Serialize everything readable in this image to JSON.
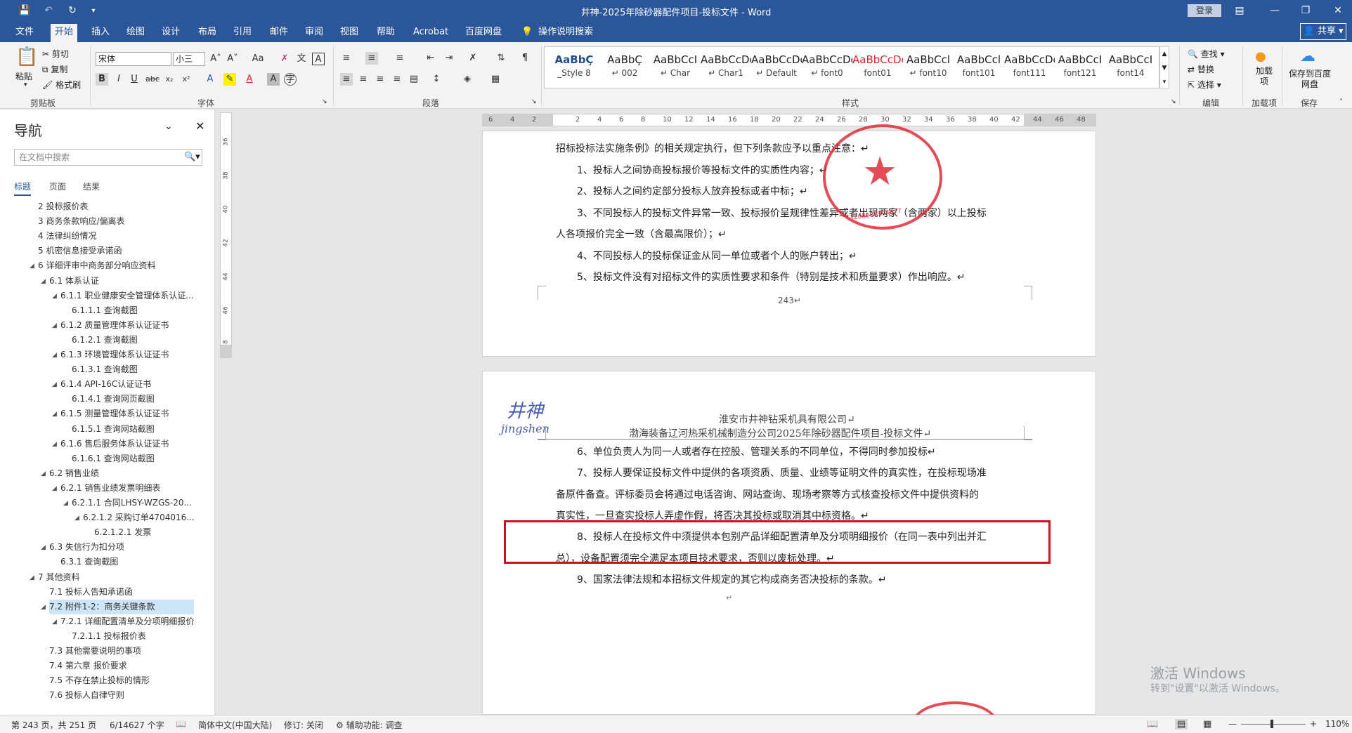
{
  "window": {
    "title": "井神-2025年除砂器配件项目-投标文件 - Word",
    "login_label": "登录",
    "share_label": "共享"
  },
  "tabs": [
    "文件",
    "开始",
    "插入",
    "绘图",
    "设计",
    "布局",
    "引用",
    "邮件",
    "审阅",
    "视图",
    "帮助",
    "Acrobat",
    "百度网盘"
  ],
  "tell_me": "操作说明搜索",
  "ribbon": {
    "clipboard": {
      "paste": "粘贴",
      "cut": "剪切",
      "copy": "复制",
      "format_painter": "格式刷",
      "label": "剪贴板"
    },
    "font": {
      "name": "宋体",
      "size": "小三",
      "label": "字体",
      "change_case": "Aa"
    },
    "paragraph": {
      "label": "段落"
    },
    "styles": {
      "label": "样式",
      "items": [
        {
          "sample": "AaBbÇ",
          "name": "_Style 8",
          "color": "#1f4e8c"
        },
        {
          "sample": "AaBbÇ",
          "name": "↵ 002",
          "color": "#222"
        },
        {
          "sample": "AaBbCcI",
          "name": "↵ Char",
          "color": "#222"
        },
        {
          "sample": "AaBbCcDc",
          "name": "↵ Char1",
          "color": "#222"
        },
        {
          "sample": "AaBbCcDc",
          "name": "↵ Default",
          "color": "#222"
        },
        {
          "sample": "AaBbCcDc",
          "name": "↵ font0",
          "color": "#222"
        },
        {
          "sample": "AaBbCcDc",
          "name": "font01",
          "color": "#e0242f"
        },
        {
          "sample": "AaBbCcl",
          "name": "↵ font10",
          "color": "#222"
        },
        {
          "sample": "AaBbCcl",
          "name": "font101",
          "color": "#222"
        },
        {
          "sample": "AaBbCcDc",
          "name": "font111",
          "color": "#222"
        },
        {
          "sample": "AaBbCcI",
          "name": "font121",
          "color": "#222"
        },
        {
          "sample": "AaBbCcI",
          "name": "font14",
          "color": "#222"
        }
      ]
    },
    "editing": {
      "find": "查找",
      "replace": "替换",
      "select": "选择",
      "label": "编辑"
    },
    "addins": {
      "addin": "加载项",
      "label": "加载项"
    },
    "save": {
      "button": "保存到百度网盘",
      "label": "保存"
    }
  },
  "nav": {
    "title": "导航",
    "search_placeholder": "在文档中搜索",
    "tabs": [
      "标题",
      "页面",
      "结果"
    ],
    "items": [
      {
        "text": "2 投标报价表",
        "indent": 0,
        "arrow": false
      },
      {
        "text": "3 商务条款响应/偏离表",
        "indent": 0,
        "arrow": false
      },
      {
        "text": "4 法律纠纷情况",
        "indent": 0,
        "arrow": false
      },
      {
        "text": "5 机密信息接受承诺函",
        "indent": 0,
        "arrow": false
      },
      {
        "text": "6 详细评审中商务部分响应资料",
        "indent": 0,
        "arrow": true
      },
      {
        "text": "6.1 体系认证",
        "indent": 1,
        "arrow": true
      },
      {
        "text": "6.1.1 职业健康安全管理体系认证...",
        "indent": 2,
        "arrow": true
      },
      {
        "text": "6.1.1.1 查询截图",
        "indent": 3,
        "arrow": false
      },
      {
        "text": "6.1.2 质量管理体系认证证书",
        "indent": 2,
        "arrow": true
      },
      {
        "text": "6.1.2.1 查询截图",
        "indent": 3,
        "arrow": false
      },
      {
        "text": "6.1.3 环境管理体系认证证书",
        "indent": 2,
        "arrow": true
      },
      {
        "text": "6.1.3.1 查询截图",
        "indent": 3,
        "arrow": false
      },
      {
        "text": "6.1.4 API-16C认证证书",
        "indent": 2,
        "arrow": true
      },
      {
        "text": "6.1.4.1 查询网页截图",
        "indent": 3,
        "arrow": false
      },
      {
        "text": "6.1.5 测量管理体系认证证书",
        "indent": 2,
        "arrow": true
      },
      {
        "text": "6.1.5.1 查询网站截图",
        "indent": 3,
        "arrow": false
      },
      {
        "text": "6.1.6 售后服务体系认证证书",
        "indent": 2,
        "arrow": true
      },
      {
        "text": "6.1.6.1 查询网站截图",
        "indent": 3,
        "arrow": false
      },
      {
        "text": "6.2 销售业绩",
        "indent": 1,
        "arrow": true
      },
      {
        "text": "6.2.1 销售业绩发票明细表",
        "indent": 2,
        "arrow": true
      },
      {
        "text": "6.2.1.1 合同LHSY-WZGS-20...",
        "indent": 3,
        "arrow": true
      },
      {
        "text": "6.2.1.2 采购订单4704016...",
        "indent": 4,
        "arrow": true
      },
      {
        "text": "6.2.1.2.1 发票",
        "indent": 5,
        "arrow": false
      },
      {
        "text": "6.3 失信行为扣分项",
        "indent": 1,
        "arrow": true
      },
      {
        "text": "6.3.1 查询截图",
        "indent": 2,
        "arrow": false
      },
      {
        "text": "7 其他资料",
        "indent": 0,
        "arrow": true
      },
      {
        "text": "7.1 投标人告知承诺函",
        "indent": 1,
        "arrow": false
      },
      {
        "text": "7.2 附件1-2：商务关键条款",
        "indent": 1,
        "arrow": true,
        "selected": true
      },
      {
        "text": "7.2.1 详细配置清单及分项明细报价",
        "indent": 2,
        "arrow": true
      },
      {
        "text": "7.2.1.1 投标报价表",
        "indent": 3,
        "arrow": false
      },
      {
        "text": "7.3 其他需要说明的事项",
        "indent": 1,
        "arrow": false
      },
      {
        "text": "7.4 第六章  报价要求",
        "indent": 1,
        "arrow": false
      },
      {
        "text": "7.5 不存在禁止投标的情形",
        "indent": 1,
        "arrow": false
      },
      {
        "text": "7.6 投标人自律守则",
        "indent": 1,
        "arrow": false
      }
    ]
  },
  "ruler": {
    "h_ticks": [
      "6",
      "4",
      "2",
      "",
      "2",
      "4",
      "6",
      "8",
      "10",
      "12",
      "14",
      "16",
      "18",
      "20",
      "22",
      "24",
      "26",
      "28",
      "30",
      "32",
      "34",
      "36",
      "38",
      "40",
      "42",
      "44",
      "46",
      "48"
    ],
    "v_ticks": [
      "36",
      "38",
      "40",
      "42",
      "44",
      "46",
      "48"
    ]
  },
  "page1": {
    "lines": [
      "招标投标法实施条例》的相关规定执行，但下列条款应予以重点注意：↵",
      "1、投标人之间协商投标报价等投标文件的实质性内容；↵",
      "2、投标人之间约定部分投标人放弃投标或者中标；↵",
      "3、不同投标人的投标文件异常一致、投标报价呈规律性差异或者出现两家（含两家）以上投标",
      "人各项报价完全一致（含最高限价）；↵",
      "4、不同投标人的投标保证金从同一单位或者个人的账户转出；↵",
      "5、投标文件没有对招标文件的实质性要求和条件（特别是技术和质量要求）作出响应。↵"
    ],
    "page_number": "243↵",
    "stamp_number": "3208030994677"
  },
  "page2": {
    "logo_cn": "井神",
    "logo_en": "jingshen",
    "header1": "淮安市井神钻采机具有限公司↵",
    "header2": "渤海装备辽河热采机械制造分公司2025年除砂器配件项目-投标文件↵",
    "lines": [
      "6、单位负责人为同一人或者存在控股、管理关系的不同单位，不得同时参加投标↵",
      "7、投标人要保证投标文件中提供的各项资质、质量、业绩等证明文件的真实性，在投标现场准",
      "备原件备查。评标委员会将通过电话咨询、网站查询、现场考察等方式核查投标文件中提供资料的",
      "真实性，一旦查实投标人弄虚作假，将否决其投标或取消其中标资格。↵",
      "8、投标人在投标文件中须提供本包别产品详细配置清单及分项明细报价（在同一表中列出并汇",
      "总），设备配置须完全满足本项目技术要求，否则以废标处理。↵",
      "9、国家法律法规和本招标文件规定的其它构成商务否决投标的条款。↵",
      "↵"
    ]
  },
  "status": {
    "page": "第 243 页，共 251 页",
    "words": "6/14627 个字",
    "language": "简体中文(中国大陆)",
    "track": "修订: 关闭",
    "accessibility": "辅助功能: 调查",
    "zoom": "110%"
  },
  "watermark": {
    "line1": "激活 Windows",
    "line2": "转到\"设置\"以激活 Windows。"
  },
  "colors": {
    "brand": "#2b579a",
    "stamp": "#e0242f",
    "highlight_box": "#d0101a"
  }
}
